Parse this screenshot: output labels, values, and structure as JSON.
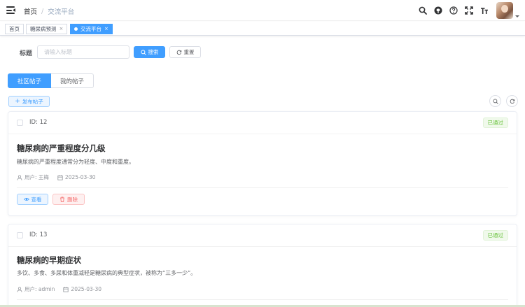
{
  "header": {
    "breadcrumb": {
      "home": "首页",
      "separator": "/",
      "current": "交流平台"
    },
    "icons": [
      "search-icon",
      "github-icon",
      "help-icon",
      "fullscreen-icon",
      "font-size-icon"
    ]
  },
  "tags_view": {
    "tags": [
      {
        "label": "首页",
        "closable": false,
        "active": false
      },
      {
        "label": "糖尿病预测",
        "closable": true,
        "active": false
      },
      {
        "label": "交流平台",
        "closable": true,
        "active": true
      }
    ],
    "close_glyph": "×"
  },
  "search": {
    "label": "标题",
    "placeholder": "请输入标题",
    "value": "",
    "search_button": "搜索",
    "reset_button": "重置"
  },
  "tabs": {
    "community": "社区帖子",
    "mine": "我的帖子"
  },
  "toolbar": {
    "publish_button": "发布帖子",
    "publish_prefix": "+"
  },
  "posts": [
    {
      "id_text": "ID: 12",
      "status": "已通过",
      "title": "糖尿病的严重程度分几级",
      "content": "糖尿病的严重程度通常分为轻度、中度和重度。",
      "user": "用户: 王梅",
      "date": "2025-03-30",
      "view_button": "查看",
      "delete_button": "删除"
    },
    {
      "id_text": "ID: 13",
      "status": "已通过",
      "title": "糖尿病的早期症状",
      "content": "多饮、多食、多尿和体重减轻是糖尿病的典型症状，被称为“三多一少”。",
      "user": "用户: admin",
      "date": "2025-03-30"
    }
  ],
  "colors": {
    "primary": "#409eff",
    "success": "#67c23a",
    "danger": "#f56c6c"
  }
}
